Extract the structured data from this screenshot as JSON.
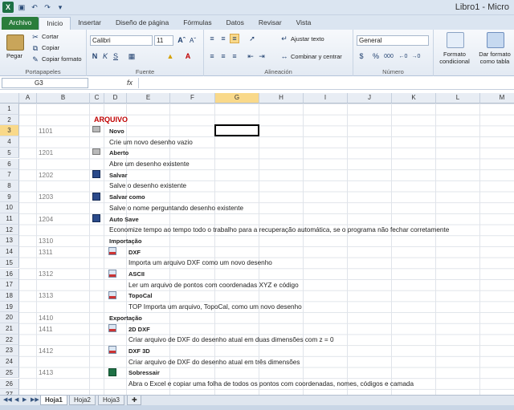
{
  "window": {
    "title": "Libro1 - Micro",
    "qat_icons": [
      "excel-logo-icon",
      "save-icon",
      "undo-icon",
      "redo-icon",
      "customize-icon"
    ]
  },
  "tabs": [
    "Archivo",
    "Inicio",
    "Insertar",
    "Diseño de página",
    "Fórmulas",
    "Datos",
    "Revisar",
    "Vista"
  ],
  "ribbon": {
    "clipboard": {
      "label": "Portapapeles",
      "paste": "Pegar",
      "cut": "Cortar",
      "copy": "Copiar",
      "copy_format": "Copiar formato"
    },
    "font": {
      "label": "Fuente",
      "name": "Calibri",
      "size": "11"
    },
    "alignment": {
      "label": "Alineación",
      "wrap": "Ajustar texto",
      "merge": "Combinar y centrar"
    },
    "number": {
      "label": "Número",
      "format": "General",
      "currency": "$",
      "percent": "%",
      "thousands": "000"
    },
    "styles": {
      "conditional": "Formato condicional",
      "table": "Dar formato como tabla"
    }
  },
  "formula_bar": {
    "name_box": "G3",
    "fx": "fx",
    "content": ""
  },
  "columns": [
    "A",
    "B",
    "C",
    "D",
    "E",
    "F",
    "G",
    "H",
    "I",
    "J",
    "K",
    "L",
    "M"
  ],
  "selected_column": "G",
  "rows": [
    "1",
    "2",
    "3",
    "4",
    "5",
    "6",
    "7",
    "8",
    "9",
    "10",
    "11",
    "12",
    "13",
    "14",
    "15",
    "16",
    "17",
    "18",
    "19",
    "20",
    "21",
    "22",
    "23",
    "24",
    "25",
    "26",
    "27"
  ],
  "selected_row": "3",
  "cells": {
    "r2": "ARQUIVO",
    "r3_code": "1101",
    "r3_title": "Novo",
    "r4": "Crie um novo desenho vazio",
    "r5_code": "1201",
    "r5_title": "Aberto",
    "r6": "Abre um desenho existente",
    "r7_code": "1202",
    "r7_title": "Salvar",
    "r8": "Salve o desenho existente",
    "r9_code": "1203",
    "r9_title": "Salvar como",
    "r10": "Salve o nome perguntando desenho existente",
    "r11_code": "1204",
    "r11_title": "Auto Save",
    "r12": "Economize tempo ao tempo todo o trabalho para a recuperação automática, se o programa não fechar corretamente",
    "r13_code": "1310",
    "r13_title": "Importação",
    "r14_code": "1311",
    "r14_title": "DXF",
    "r15": "Importa um arquivo DXF como um novo desenho",
    "r16_code": "1312",
    "r16_title": "ASCII",
    "r17": "Ler um arquivo de pontos com coordenadas XYZ e código",
    "r18_code": "1313",
    "r18_title": "TopoCal",
    "r19": "TOP Importa um arquivo, TopoCal, como um novo desenho",
    "r20_code": "1410",
    "r20_title": "Exportação",
    "r21_code": "1411",
    "r21_title": "2D DXF",
    "r22": "Criar arquivo de DXF do desenho atual em duas dimensões com z = 0",
    "r23_code": "1412",
    "r23_title": "DXF 3D",
    "r24": "Criar arquivo de DXF do desenho atual em três dimensões",
    "r25_code": "1413",
    "r25_title": "Sobressair",
    "r26": "Abra o Excel e copiar uma folha de todos os pontos com coordenadas, nomes, códigos e camada"
  },
  "sheets": [
    "Hoja1",
    "Hoja2",
    "Hoja3"
  ],
  "active_sheet": "Hoja1",
  "colors": {
    "file_tab": "#2a7d3c",
    "header_selected": "#f9d98a",
    "title_red": "#c00000"
  }
}
